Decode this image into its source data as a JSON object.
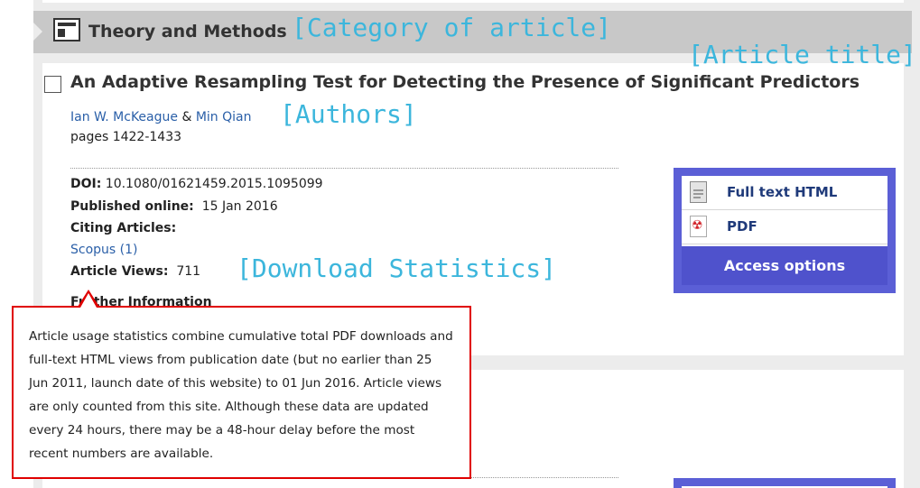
{
  "category": {
    "label": "Theory and Methods"
  },
  "annotations": {
    "category": "[Category of article]",
    "title": "[Article title]",
    "authors": "[Authors]",
    "download": "[Download Statistics]"
  },
  "article": {
    "title": "An Adaptive Resampling Test for Detecting the Presence of Significant Predictors",
    "authors": [
      "Ian W. McKeague",
      "Min Qian"
    ],
    "author_separator": "&",
    "pages": "pages 1422-1433",
    "doi_label": "DOI:",
    "doi_value": "10.1080/01621459.2015.1095099",
    "published_label": "Published online:",
    "published_value": "15 Jan 2016",
    "citing_label": "Citing Articles:",
    "citing_link": "Scopus (1)",
    "views_label": "Article Views:",
    "views_value": "711",
    "further_label": "Further Information"
  },
  "access": {
    "full_text": "Full text HTML",
    "pdf": "PDF",
    "button": "Access options"
  },
  "tooltip": {
    "text": "Article usage statistics combine cumulative total PDF downloads and full-text HTML views from publication date (but no earlier than 25 Jun 2011, launch date of this website) to 01 Jun 2016. Article views are only counted from this site. Although these data are updated every 24 hours, there may be a 48-hour delay before the most recent numbers are available."
  },
  "colors": {
    "accent_blue": "#5b5fd6",
    "annotation_cyan": "#3cb6dc",
    "tooltip_border": "#e00000",
    "link": "#2a5fa8"
  }
}
